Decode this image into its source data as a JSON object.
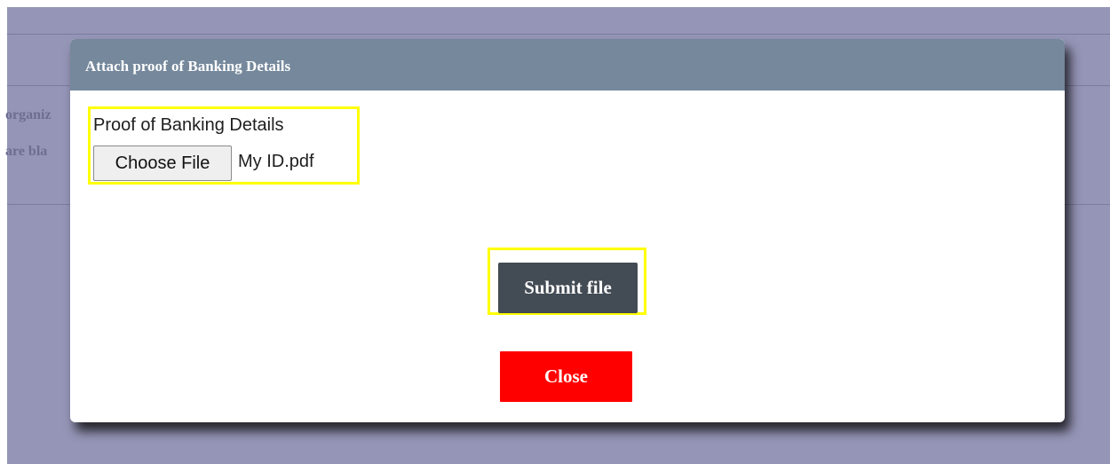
{
  "background": {
    "text_line_1": "organiz",
    "text_line_2": "are bla"
  },
  "modal": {
    "title": "Attach proof of Banking Details",
    "file_field": {
      "label": "Proof of Banking Details",
      "choose_button_label": "Choose File",
      "selected_file": "My ID.pdf"
    },
    "submit_button_label": "Submit file",
    "close_button_label": "Close"
  },
  "colors": {
    "backdrop": "#9595b7",
    "header": "#75889c",
    "highlight": "#ffff00",
    "submit_button": "#434b54",
    "close_button": "#ff0000"
  }
}
